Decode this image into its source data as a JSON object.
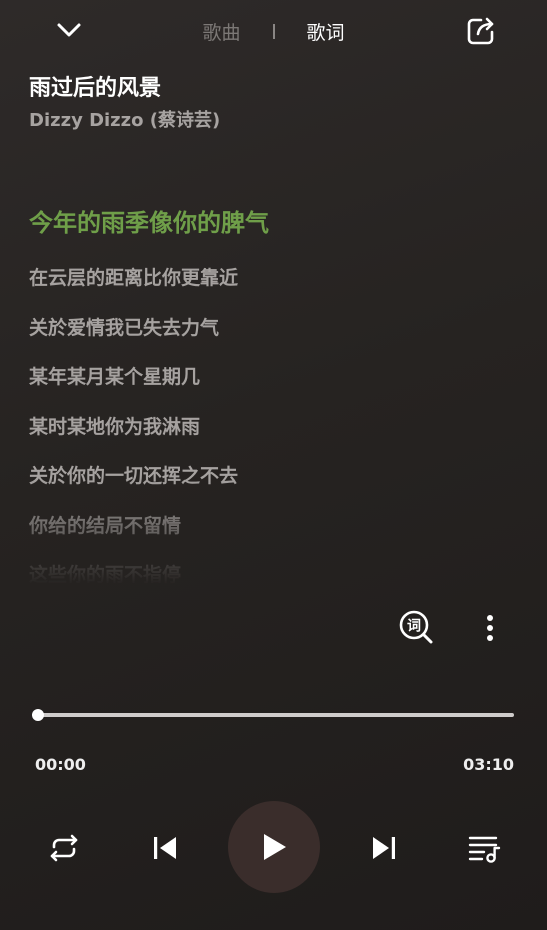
{
  "header": {
    "tabs": [
      {
        "label": "歌曲",
        "active": false
      },
      {
        "label": "歌词",
        "active": true
      }
    ],
    "collapse_icon": "chevron-down-icon",
    "share_icon": "share-icon"
  },
  "song": {
    "title": "雨过后的风景",
    "artist": "Dizzy Dizzo (蔡诗芸)"
  },
  "lyrics": {
    "current_index": 0,
    "lines": [
      "今年的雨季像你的脾气",
      "在云层的距离比你更靠近",
      "关於爱情我已失去力气",
      "某年某月某个星期几",
      "某时某地你为我淋雨",
      "关於你的一切还挥之不去",
      "你给的结局不留情",
      "这些你的雨不指停"
    ]
  },
  "tools": {
    "lyric_search_icon": "lyric-search-icon",
    "lyric_search_glyph": "词",
    "more_icon": "more-vertical-icon"
  },
  "player": {
    "current_time": "00:00",
    "total_time": "03:10",
    "progress": 0.0,
    "repeat_icon": "repeat-icon",
    "prev_icon": "skip-previous-icon",
    "play_icon": "play-icon",
    "next_icon": "skip-next-icon",
    "playlist_icon": "playlist-icon"
  },
  "colors": {
    "accent_current_lyric": "#6f9f49",
    "lyric_text": "#a6a2a0",
    "play_button_bg": "#3a2d2b",
    "background": "#262321"
  }
}
